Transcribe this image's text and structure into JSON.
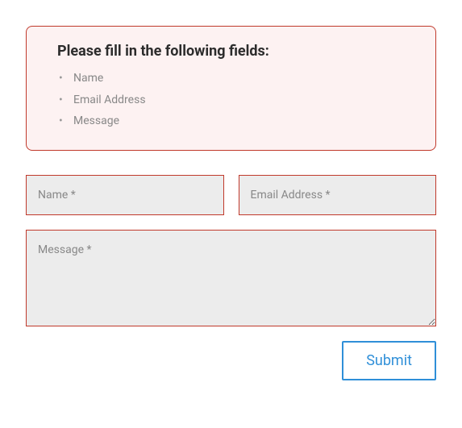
{
  "error": {
    "title": "Please fill in the following fields:",
    "items": [
      "Name",
      "Email Address",
      "Message"
    ]
  },
  "form": {
    "name_placeholder": "Name *",
    "email_placeholder": "Email Address *",
    "message_placeholder": "Message *",
    "submit_label": "Submit"
  }
}
